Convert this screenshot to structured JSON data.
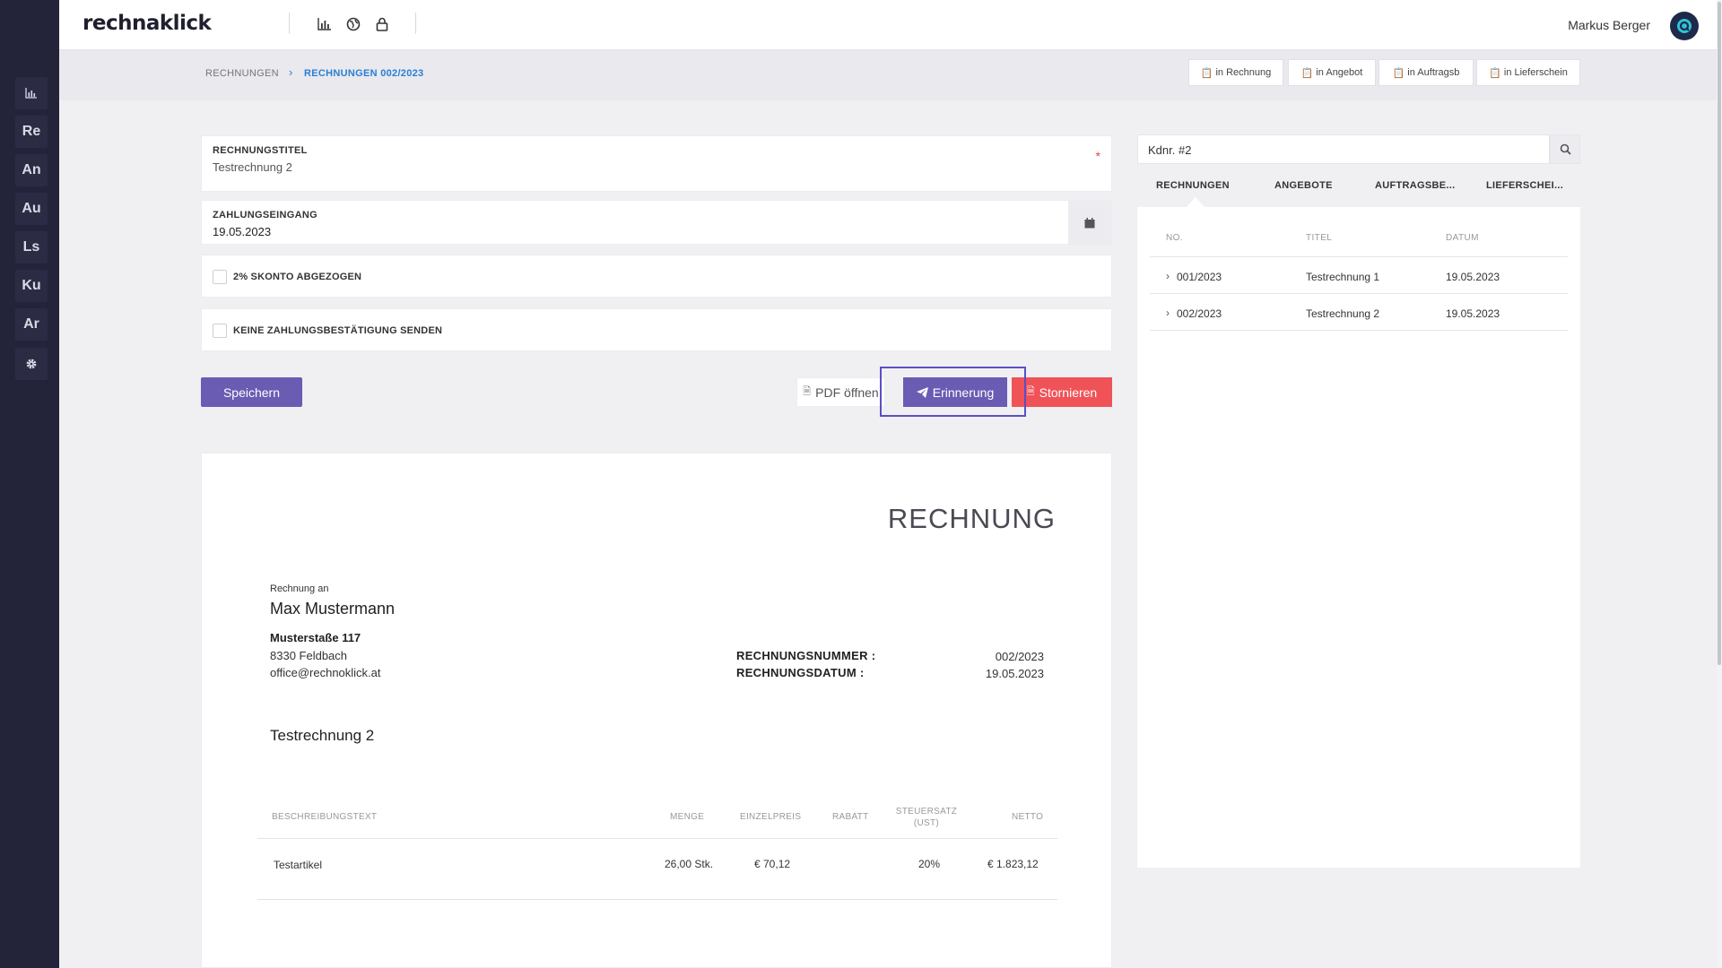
{
  "colors": {
    "sidebar": "#23233a",
    "accent": "#6a5bb3",
    "danger": "#ef5358",
    "link": "#2a7fd3"
  },
  "sidebar": {
    "items": [
      {
        "label": "",
        "icon": "bar-chart-icon"
      },
      {
        "label": "Re"
      },
      {
        "label": "An"
      },
      {
        "label": "Au"
      },
      {
        "label": "Ls"
      },
      {
        "label": "Ku"
      },
      {
        "label": "Ar"
      },
      {
        "label": "",
        "icon": "gear-icon"
      }
    ]
  },
  "topbar": {
    "logo": "rechnaklick",
    "icons": [
      "bar-chart-icon",
      "globe-icon",
      "lock-icon"
    ],
    "user_name": "Markus Berger"
  },
  "breadcrumb": {
    "root": "RECHNUNGEN",
    "current": "RECHNUNGEN 002/2023"
  },
  "convert_buttons": [
    "in Rechnung",
    "in Angebot",
    "in Auftragsb",
    "in Lieferschein"
  ],
  "form": {
    "title_label": "RECHNUNGSTITEL",
    "title_value": "Testrechnung 2",
    "required_mark": "*",
    "payment_label": "ZAHLUNGSEINGANG",
    "payment_value": "19.05.2023",
    "checkbox_skonto": "2% SKONTO ABGEZOGEN",
    "checkbox_no_confirm": "KEINE ZAHLUNGSBESTÄTIGUNG SENDEN"
  },
  "actions": {
    "save": "Speichern",
    "pdf": "PDF öffnen",
    "reminder": "Erinnerung",
    "cancel": "Stornieren"
  },
  "invoice": {
    "heading": "RECHNUNG",
    "to_label": "Rechnung an",
    "customer_name": "Max Mustermann",
    "street": "Musterstaße 117",
    "city": "8330 Feldbach",
    "email": "office@rechnoklick.at",
    "number_label": "RECHNUNGSNUMMER :",
    "number_value": "002/2023",
    "date_label": "RECHNUNGSDATUM :",
    "date_value": "19.05.2023",
    "subject": "Testrechnung 2",
    "columns": {
      "description": "BESCHREIBUNGSTEXT",
      "qty": "MENGE",
      "unit_price": "EINZELPREIS",
      "discount": "RABATT",
      "tax": "STEUERSATZ (UST)",
      "net": "NETTO"
    },
    "rows": [
      {
        "description": "Testartikel",
        "qty": "26,00 Stk.",
        "unit_price": "€ 70,12",
        "discount": "",
        "tax": "20%",
        "net": "€ 1.823,12"
      }
    ]
  },
  "right_panel": {
    "search_value": "Kdnr. #2",
    "tabs": [
      "RECHNUNGEN",
      "ANGEBOTE",
      "AUFTRAGSBE...",
      "LIEFERSCHEI..."
    ],
    "columns": {
      "no": "NO.",
      "title": "TITEL",
      "date": "DATUM"
    },
    "rows": [
      {
        "no": "001/2023",
        "title": "Testrechnung 1",
        "date": "19.05.2023"
      },
      {
        "no": "002/2023",
        "title": "Testrechnung 2",
        "date": "19.05.2023"
      }
    ]
  }
}
